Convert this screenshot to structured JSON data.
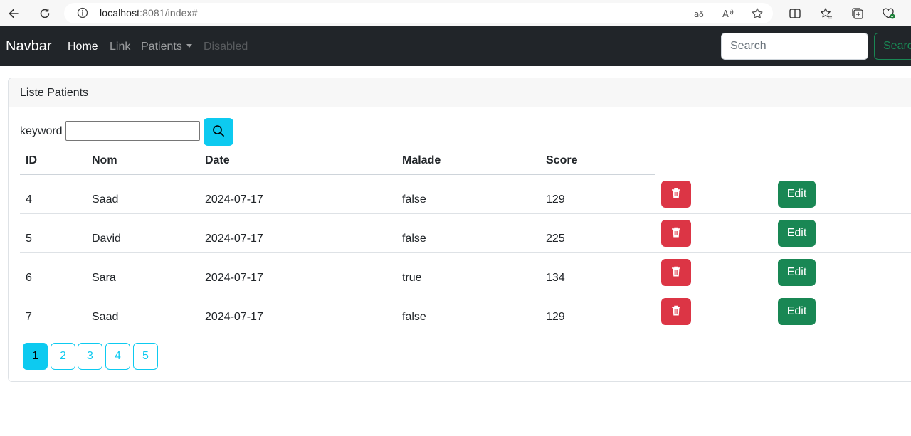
{
  "browser": {
    "url_host": "localhost",
    "url_rest": ":8081/index#"
  },
  "navbar": {
    "brand": "Navbar",
    "links": [
      {
        "label": "Home",
        "state": "active"
      },
      {
        "label": "Link",
        "state": "normal"
      },
      {
        "label": "Patients",
        "state": "dropdown"
      },
      {
        "label": "Disabled",
        "state": "disabled"
      }
    ],
    "search_placeholder": "Search",
    "search_button": "Search"
  },
  "card": {
    "title": "Liste Patients",
    "keyword_label": "keyword",
    "keyword_value": "",
    "columns": [
      "ID",
      "Nom",
      "Date",
      "Malade",
      "Score"
    ],
    "rows": [
      {
        "id": "4",
        "nom": "Saad",
        "date": "2024-07-17",
        "malade": "false",
        "score": "129"
      },
      {
        "id": "5",
        "nom": "David",
        "date": "2024-07-17",
        "malade": "false",
        "score": "225"
      },
      {
        "id": "6",
        "nom": "Sara",
        "date": "2024-07-17",
        "malade": "true",
        "score": "134"
      },
      {
        "id": "7",
        "nom": "Saad",
        "date": "2024-07-17",
        "malade": "false",
        "score": "129"
      }
    ],
    "edit_label": "Edit",
    "pages": [
      "1",
      "2",
      "3",
      "4",
      "5"
    ],
    "current_page": "1"
  },
  "colors": {
    "navbar_bg": "#212529",
    "info": "#0dcaf0",
    "danger": "#dc3545",
    "success": "#198754"
  },
  "icons": {
    "back": "arrow-left-icon",
    "reload": "reload-icon",
    "info": "info-icon",
    "search": "search-icon",
    "delete": "trash-icon"
  }
}
